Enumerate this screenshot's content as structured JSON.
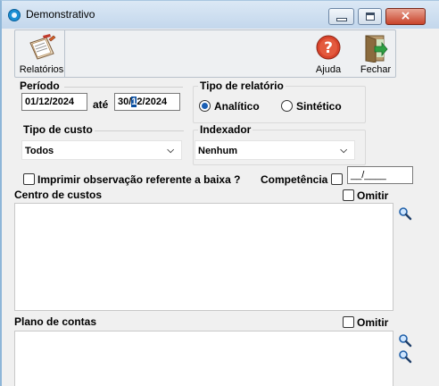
{
  "window": {
    "title": "Demonstrativo",
    "minimize": "minimize",
    "maximize": "maximize",
    "close": "×"
  },
  "toolbar": {
    "relatorios": "Relatórios",
    "ajuda": "Ajuda",
    "fechar": "Fechar"
  },
  "periodo": {
    "label": "Período",
    "from": "01/12/2024",
    "ate": "até",
    "to_pre": "30/",
    "to_sel": "1",
    "to_post": "2/2024"
  },
  "tipo_relatorio": {
    "label": "Tipo de relatório",
    "options": [
      "Analítico",
      "Sintético"
    ],
    "selected": "Analítico"
  },
  "tipo_custo": {
    "label": "Tipo de custo",
    "value": "Todos"
  },
  "indexador": {
    "label": "Indexador",
    "value": "Nenhum"
  },
  "imprimir_obs": {
    "label": "Imprimir observação referente a baixa ?",
    "checked": false
  },
  "competencia": {
    "label": "Competência",
    "checked": false,
    "value": "__/____"
  },
  "centro_custos": {
    "label": "Centro de custos",
    "omitir": "Omitir",
    "omitir_checked": false
  },
  "plano_contas": {
    "label": "Plano de contas",
    "omitir": "Omitir",
    "omitir_checked": false
  },
  "icons": {
    "app": "app-icon",
    "report": "clipboard-pen-icon",
    "help": "question-icon",
    "exit": "door-exit-icon",
    "search": "magnifier-icon",
    "dropdown": "chevron-down-icon"
  },
  "colors": {
    "accent": "#1a5fb4",
    "title_bar": "#c3d7ec",
    "close_button": "#c8432b"
  }
}
